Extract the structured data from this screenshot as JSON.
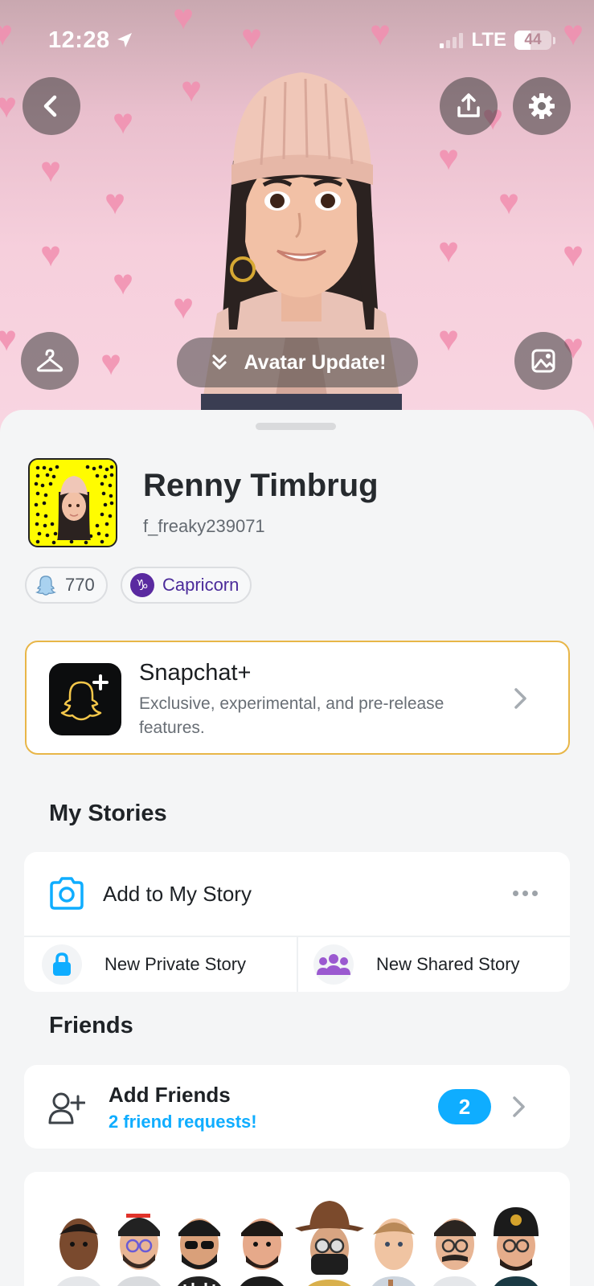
{
  "status_bar": {
    "time": "12:28",
    "network": "LTE",
    "battery": "44"
  },
  "hero": {
    "avatar_update_label": "Avatar Update!"
  },
  "profile": {
    "display_name": "Renny Timbrug",
    "username": "f_freaky239071",
    "score": "770",
    "zodiac": "Capricorn"
  },
  "snapchat_plus": {
    "title": "Snapchat+",
    "description": "Exclusive, experimental, and pre-release features."
  },
  "my_stories": {
    "title": "My Stories",
    "add_label": "Add to My Story",
    "private_label": "New Private Story",
    "shared_label": "New Shared Story"
  },
  "friends": {
    "title": "Friends",
    "add_friends_label": "Add Friends",
    "requests_label": "2 friend requests!",
    "badge_count": "2"
  },
  "colors": {
    "accent_blue": "#0fadff",
    "snap_yellow": "#fffc00",
    "plus_gold": "#e8b648"
  }
}
